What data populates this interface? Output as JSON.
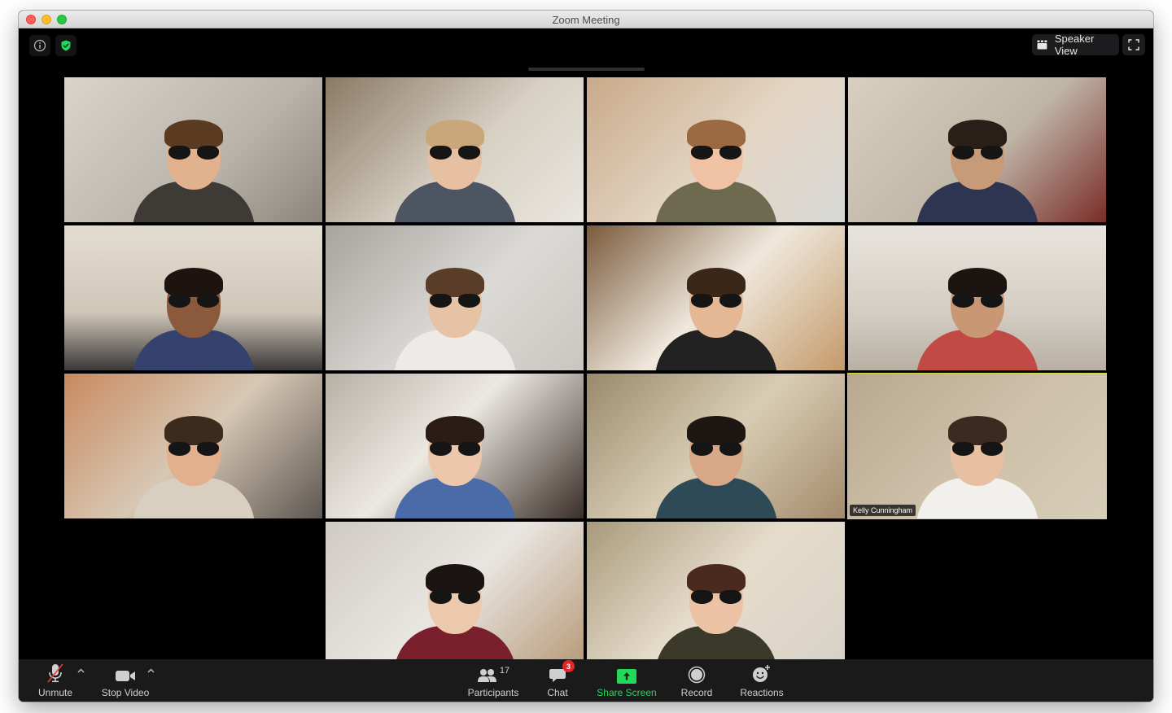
{
  "window": {
    "title": "Zoom Meeting"
  },
  "top_bar": {
    "info_icon": "info-icon",
    "security_icon": "shield-check-icon",
    "speaker_view_label": "Speaker View",
    "fullscreen_icon": "fullscreen-icon"
  },
  "gallery": {
    "tiles": [
      {
        "id": 1,
        "row": 1,
        "col": 1,
        "name": ""
      },
      {
        "id": 2,
        "row": 1,
        "col": 2,
        "name": ""
      },
      {
        "id": 3,
        "row": 1,
        "col": 3,
        "name": ""
      },
      {
        "id": 4,
        "row": 1,
        "col": 4,
        "name": ""
      },
      {
        "id": 5,
        "row": 2,
        "col": 1,
        "name": ""
      },
      {
        "id": 6,
        "row": 2,
        "col": 2,
        "name": ""
      },
      {
        "id": 7,
        "row": 2,
        "col": 3,
        "name": ""
      },
      {
        "id": 8,
        "row": 2,
        "col": 4,
        "name": ""
      },
      {
        "id": 9,
        "row": 3,
        "col": 1,
        "name": ""
      },
      {
        "id": 10,
        "row": 3,
        "col": 2,
        "name": ""
      },
      {
        "id": 11,
        "row": 3,
        "col": 3,
        "name": ""
      },
      {
        "id": 12,
        "row": 3,
        "col": 4,
        "name": "Kelly Cunningham",
        "active_speaker": true
      },
      {
        "id": 13,
        "row": 4,
        "col": 2,
        "name": ""
      },
      {
        "id": 14,
        "row": 4,
        "col": 3,
        "name": ""
      }
    ],
    "active_speaker_color": "#c9d94a"
  },
  "toolbar": {
    "unmute_label": "Unmute",
    "stop_video_label": "Stop Video",
    "participants_label": "Participants",
    "participants_count": "17",
    "chat_label": "Chat",
    "chat_badge": "3",
    "share_screen_label": "Share Screen",
    "record_label": "Record",
    "reactions_label": "Reactions",
    "share_color": "#23d959",
    "badge_color": "#e02828"
  }
}
